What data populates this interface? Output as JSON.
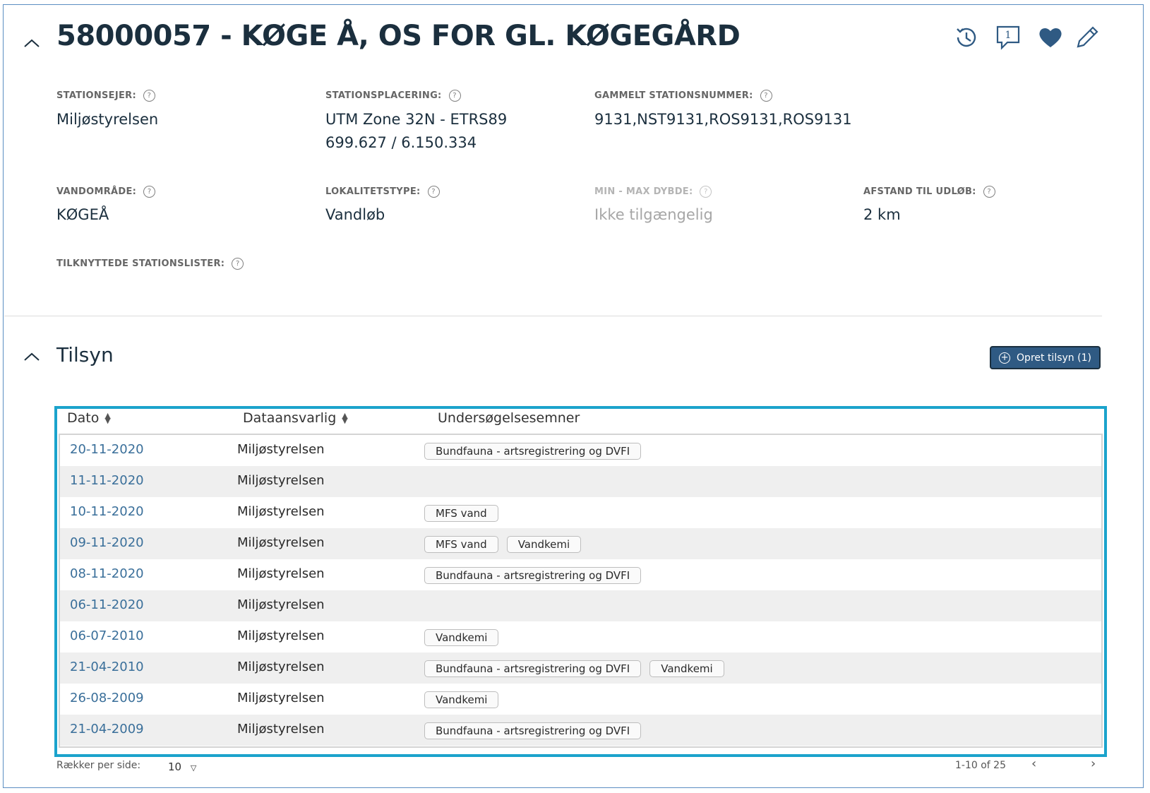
{
  "station": {
    "title": "58000057 - KØGE Å, OS FOR GL. KØGEGÅRD",
    "icons": [
      "history-icon",
      "comment-icon",
      "heart-icon",
      "edit-icon"
    ],
    "comment_badge": "1",
    "fields": {
      "owner_label": "STATIONSEJER:",
      "owner_value": "Miljøstyrelsen",
      "placement_label": "STATIONSPLACERING:",
      "placement_line1": "UTM Zone 32N - ETRS89",
      "placement_line2": "699.627 / 6.150.334",
      "old_number_label": "GAMMELT STATIONSNUMMER:",
      "old_number_value": "9131,NST9131,ROS9131,ROS9131",
      "water_area_label": "VANDOMRÅDE:",
      "water_area_value": "KØGEÅ",
      "locality_label": "LOKALITETSTYPE:",
      "locality_value": "Vandløb",
      "depth_label": "MIN - MAX DYBDE:",
      "depth_value": "Ikke tilgængelig",
      "distance_label": "AFSTAND TIL UDLØB:",
      "distance_value": "2 km",
      "lists_label": "TILKNYTTEDE STATIONSLISTER:"
    },
    "help_glyph": "?"
  },
  "tilsyn": {
    "title": "Tilsyn",
    "create_button": "Opret tilsyn (1)",
    "columns": [
      "Dato",
      "Dataansvarlig",
      "Undersøgelsesemner"
    ],
    "rows": [
      {
        "date": "20-11-2020",
        "owner": "Miljøstyrelsen",
        "tags": [
          "Bundfauna - artsregistrering og DVFI"
        ]
      },
      {
        "date": "11-11-2020",
        "owner": "Miljøstyrelsen",
        "tags": []
      },
      {
        "date": "10-11-2020",
        "owner": "Miljøstyrelsen",
        "tags": [
          "MFS vand"
        ]
      },
      {
        "date": "09-11-2020",
        "owner": "Miljøstyrelsen",
        "tags": [
          "MFS vand",
          "Vandkemi"
        ]
      },
      {
        "date": "08-11-2020",
        "owner": "Miljøstyrelsen",
        "tags": [
          "Bundfauna - artsregistrering og DVFI"
        ]
      },
      {
        "date": "06-11-2020",
        "owner": "Miljøstyrelsen",
        "tags": []
      },
      {
        "date": "06-07-2010",
        "owner": "Miljøstyrelsen",
        "tags": [
          "Vandkemi"
        ]
      },
      {
        "date": "21-04-2010",
        "owner": "Miljøstyrelsen",
        "tags": [
          "Bundfauna - artsregistrering og DVFI",
          "Vandkemi"
        ]
      },
      {
        "date": "26-08-2009",
        "owner": "Miljøstyrelsen",
        "tags": [
          "Vandkemi"
        ]
      },
      {
        "date": "21-04-2009",
        "owner": "Miljøstyrelsen",
        "tags": [
          "Bundfauna - artsregistrering og DVFI"
        ]
      }
    ],
    "footer": {
      "rows_per_page_label": "Rækker per side:",
      "rows_per_page_value": "10",
      "range_text": "1-10 of 25"
    }
  },
  "colors": {
    "accent": "#2f5a83",
    "highlight_border": "#1ba3cc",
    "link": "#3a6f9a",
    "heading": "#1b2f3e"
  }
}
